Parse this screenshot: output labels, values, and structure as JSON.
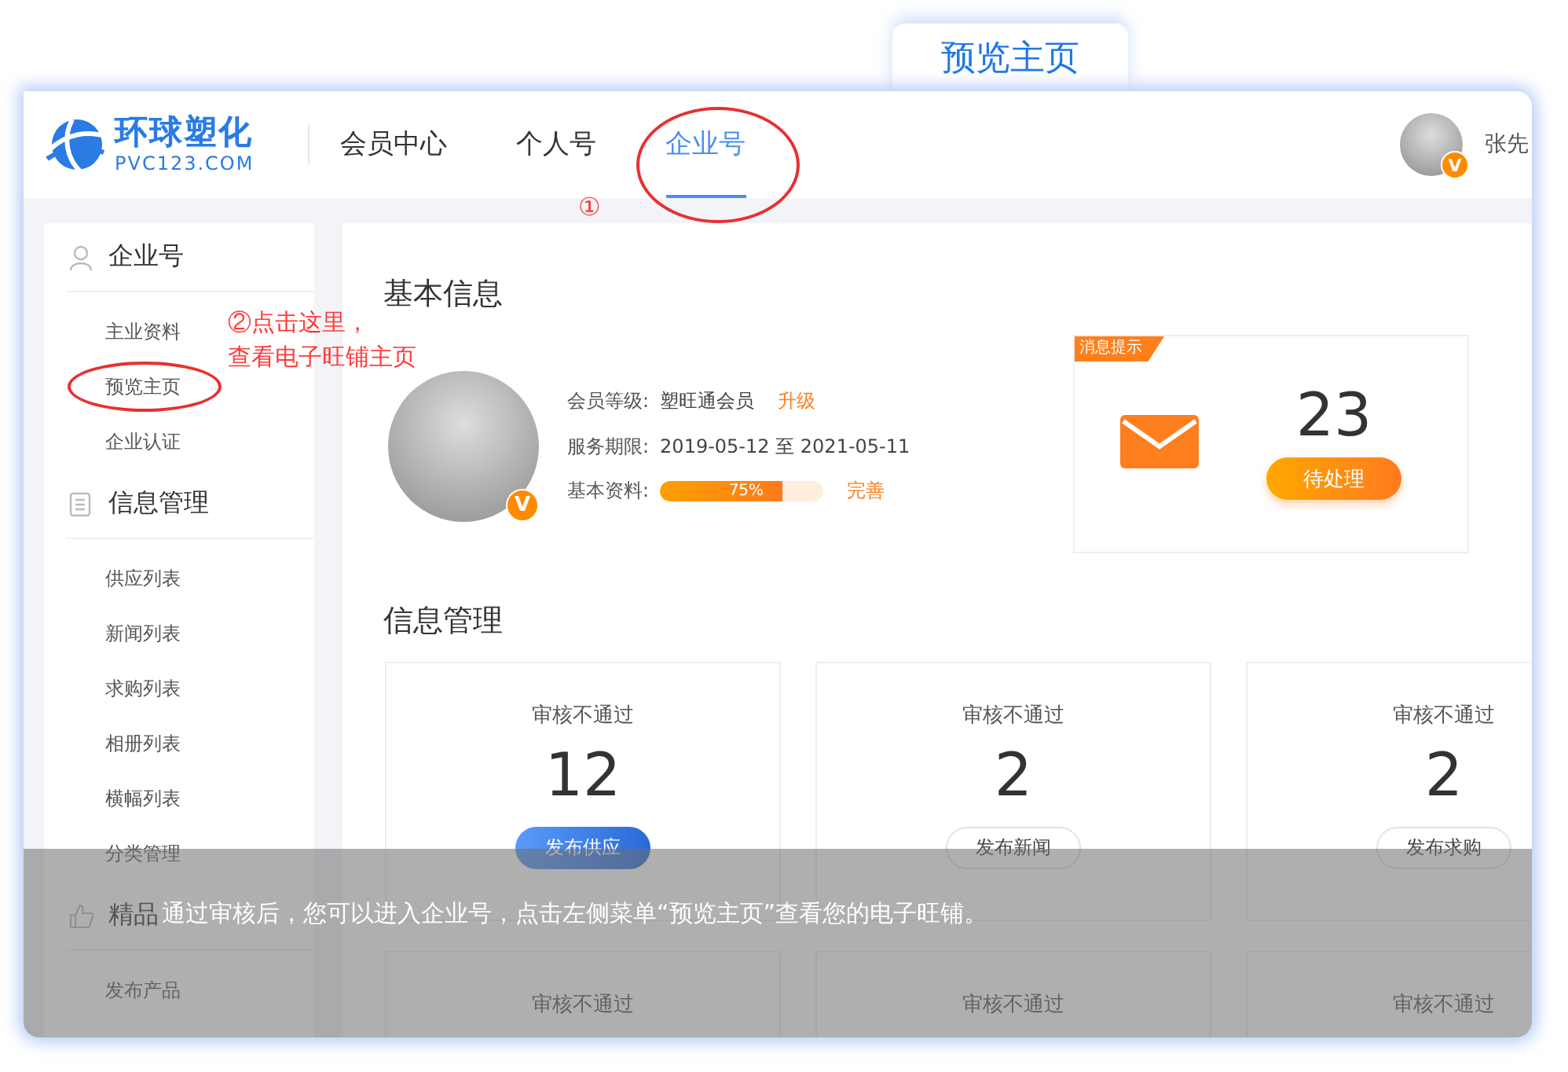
{
  "tab": {
    "label": "预览主页"
  },
  "header": {
    "logo": {
      "name": "环球塑化",
      "domain": "PVC123.COM"
    },
    "nav": [
      {
        "label": "会员中心",
        "selected": false
      },
      {
        "label": "个人号",
        "selected": false
      },
      {
        "label": "企业号",
        "selected": true
      }
    ],
    "user": {
      "name": "张先",
      "badge": "V"
    }
  },
  "sidebar": {
    "sections": [
      {
        "title": "企业号",
        "kind": "person",
        "items": [
          "主业资料",
          "预览主页",
          "企业认证"
        ]
      },
      {
        "title": "信息管理",
        "kind": "document",
        "items": [
          "供应列表",
          "新闻列表",
          "求购列表",
          "相册列表",
          "横幅列表",
          "分类管理"
        ]
      },
      {
        "title": "精品",
        "kind": "thumb",
        "items": [
          "发布产品"
        ]
      }
    ]
  },
  "basic_info": {
    "title": "基本信息",
    "badge": "V",
    "rows": [
      {
        "kind": "text",
        "label": "会员等级:",
        "value": "塑旺通会员",
        "action": "升级"
      },
      {
        "kind": "text",
        "label": "服务期限:",
        "value": "2019-05-12 至 2021-05-11"
      },
      {
        "kind": "progress",
        "label": "基本资料:",
        "level": 0.75,
        "reading": "75%",
        "action": "完善"
      }
    ]
  },
  "message_card": {
    "tag": "消息提示",
    "count": "23",
    "button": "待处理"
  },
  "info_management": {
    "title": "信息管理",
    "cards": [
      {
        "status": "审核不通过",
        "count": "12",
        "button": "发布供应",
        "kind": "primary"
      },
      {
        "status": "审核不通过",
        "count": "2",
        "button": "发布新闻",
        "kind": "outline"
      },
      {
        "status": "审核不通过",
        "count": "2",
        "button": "发布求购",
        "kind": "outline"
      },
      {
        "status": "审核不通过"
      },
      {
        "status": "审核不通过"
      },
      {
        "status": "审核不通过"
      }
    ]
  },
  "annotations": [
    {
      "kind": "step",
      "lines": [
        "①"
      ]
    },
    {
      "kind": "step",
      "lines": [
        "②点击这里，",
        "查看电子旺铺主页"
      ]
    }
  ],
  "caption": "通过审核后，您可以进入企业号，点击左侧菜单“预览主页”查看您的电子旺铺。"
}
